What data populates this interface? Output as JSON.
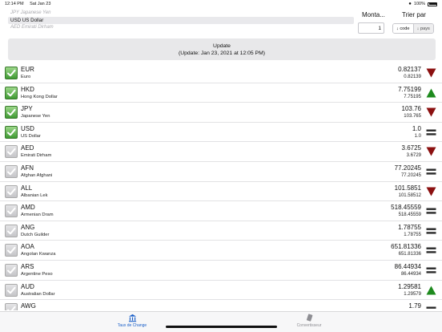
{
  "status_bar": {
    "time": "12:14 PM",
    "date": "Sat Jan 23",
    "battery": "100%"
  },
  "picker": {
    "rows": [
      "JPY Japanese Yen",
      "USD US Dollar",
      "AED Emirati Dirham"
    ]
  },
  "amount": {
    "label": "Monta...",
    "value": "1"
  },
  "sort": {
    "label": "Trier par",
    "options": [
      "↓ code",
      "↓ pays"
    ]
  },
  "update": {
    "title": "Update",
    "subtitle": "(Update: Jan 23, 2021 at 12:05 PM)"
  },
  "rates": [
    {
      "code": "EUR",
      "name": "Euro",
      "rate": "0.82137",
      "previous": "0.82139",
      "checked": true,
      "trend": "down"
    },
    {
      "code": "HKD",
      "name": "Hong Kong Dollar",
      "rate": "7.75199",
      "previous": "7.75195",
      "checked": true,
      "trend": "up"
    },
    {
      "code": "JPY",
      "name": "Japanese Yen",
      "rate": "103.76",
      "previous": "103.765",
      "checked": true,
      "trend": "down"
    },
    {
      "code": "USD",
      "name": "US Dollar",
      "rate": "1.0",
      "previous": "1.0",
      "checked": true,
      "trend": "equal"
    },
    {
      "code": "AED",
      "name": "Emirati Dirham",
      "rate": "3.6725",
      "previous": "3.6729",
      "checked": false,
      "trend": "down"
    },
    {
      "code": "AFN",
      "name": "Afghan Afghani",
      "rate": "77.20245",
      "previous": "77.20245",
      "checked": false,
      "trend": "equal"
    },
    {
      "code": "ALL",
      "name": "Albanian Lek",
      "rate": "101.5851",
      "previous": "101.58512",
      "checked": false,
      "trend": "down"
    },
    {
      "code": "AMD",
      "name": "Armenian Dram",
      "rate": "518.45559",
      "previous": "518.45559",
      "checked": false,
      "trend": "equal"
    },
    {
      "code": "ANG",
      "name": "Dutch Guilder",
      "rate": "1.78755",
      "previous": "1.78755",
      "checked": false,
      "trend": "equal"
    },
    {
      "code": "AOA",
      "name": "Angolan Kwanza",
      "rate": "651.81336",
      "previous": "651.81336",
      "checked": false,
      "trend": "equal"
    },
    {
      "code": "ARS",
      "name": "Argentine Peso",
      "rate": "86.44934",
      "previous": "86.44934",
      "checked": false,
      "trend": "equal"
    },
    {
      "code": "AUD",
      "name": "Australian Dollar",
      "rate": "1.29581",
      "previous": "1.29579",
      "checked": false,
      "trend": "up"
    },
    {
      "code": "AWG",
      "name": "",
      "rate": "1.79",
      "previous": "",
      "checked": false,
      "trend": "equal"
    }
  ],
  "tabbar": {
    "tabs": [
      {
        "label": "Taux de Change",
        "icon": "bank-icon"
      },
      {
        "label": "Convertisseur",
        "icon": "calculator-icon"
      }
    ]
  },
  "colors": {
    "up": "#1e8a1e",
    "down": "#8b1010",
    "equal": "#2a2a2a",
    "accent": "#1a5fc8"
  }
}
